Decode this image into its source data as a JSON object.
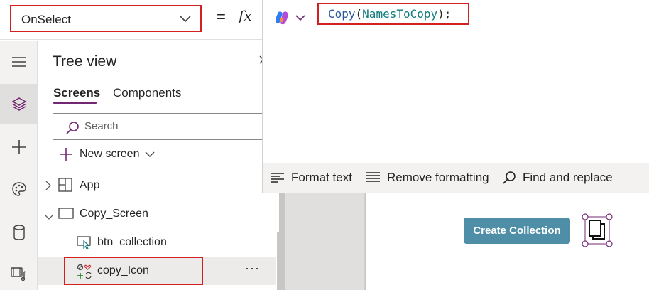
{
  "formula_bar": {
    "property": "OnSelect",
    "equals": "=",
    "fx": "fx",
    "formula": {
      "function": "Copy",
      "open": "(",
      "argument": "NamesToCopy",
      "close": ");"
    }
  },
  "editor_toolbar": {
    "format_text": "Format text",
    "remove_formatting": "Remove formatting",
    "find_replace": "Find and replace"
  },
  "rail": {
    "items": [
      "menu-icon",
      "layers-icon",
      "plus-icon",
      "palette-icon",
      "database-icon",
      "media-icon"
    ],
    "active": "layers-icon"
  },
  "tree_view": {
    "title": "Tree view",
    "tabs": [
      "Screens",
      "Components"
    ],
    "active_tab": "Screens",
    "search_placeholder": "Search",
    "new_screen": "New screen",
    "nodes": [
      {
        "label": "App",
        "icon": "app-grid-icon",
        "level": 0,
        "expandable": true
      },
      {
        "label": "Copy_Screen",
        "icon": "screen-icon",
        "level": 0,
        "expanded": true
      },
      {
        "label": "btn_collection",
        "icon": "button-icon",
        "level": 1
      },
      {
        "label": "copy_Icon",
        "icon": "icon-control-icon",
        "level": 1,
        "selected": true
      }
    ],
    "more": "···"
  },
  "canvas": {
    "button_label": "Create Collection",
    "button_color": "#4f8ea7"
  },
  "colors": {
    "highlight_border": "#d21f1f",
    "accent": "#742774",
    "code_function": "#2b579a",
    "code_argument": "#0f7b7b"
  }
}
